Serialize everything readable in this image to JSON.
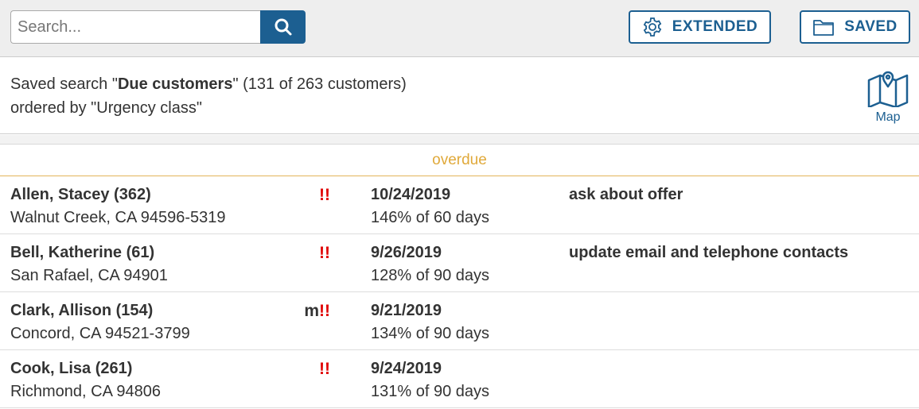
{
  "toolbar": {
    "search_placeholder": "Search...",
    "search_value": "",
    "extended_label": "EXTENDED",
    "saved_label": "SAVED"
  },
  "info": {
    "prefix": "Saved search \"",
    "search_name": "Due customers",
    "suffix": "\" (131 of 263 customers)",
    "order_line": "ordered by \"Urgency class\"",
    "map_label": "Map"
  },
  "group": {
    "label": "overdue"
  },
  "colors": {
    "accent": "#1c5f91",
    "overdue": "#e0a93a",
    "urgent": "#e00000"
  },
  "customers": [
    {
      "name": "Allen, Stacey (362)",
      "city": "Walnut Creek, CA 94596-5319",
      "flag_prefix": "",
      "flag": "!!",
      "date": "10/24/2019",
      "percent": "146% of 60 days",
      "note": "ask about offer"
    },
    {
      "name": "Bell, Katherine (61)",
      "city": "San Rafael, CA 94901",
      "flag_prefix": "",
      "flag": "!!",
      "date": "9/26/2019",
      "percent": "128% of 90 days",
      "note": "update email and telephone contacts"
    },
    {
      "name": "Clark, Allison (154)",
      "city": "Concord, CA 94521-3799",
      "flag_prefix": "m",
      "flag": "!!",
      "date": "9/21/2019",
      "percent": "134% of 90 days",
      "note": ""
    },
    {
      "name": "Cook, Lisa (261)",
      "city": "Richmond, CA 94806",
      "flag_prefix": "",
      "flag": "!!",
      "date": "9/24/2019",
      "percent": "131% of 90 days",
      "note": ""
    }
  ]
}
